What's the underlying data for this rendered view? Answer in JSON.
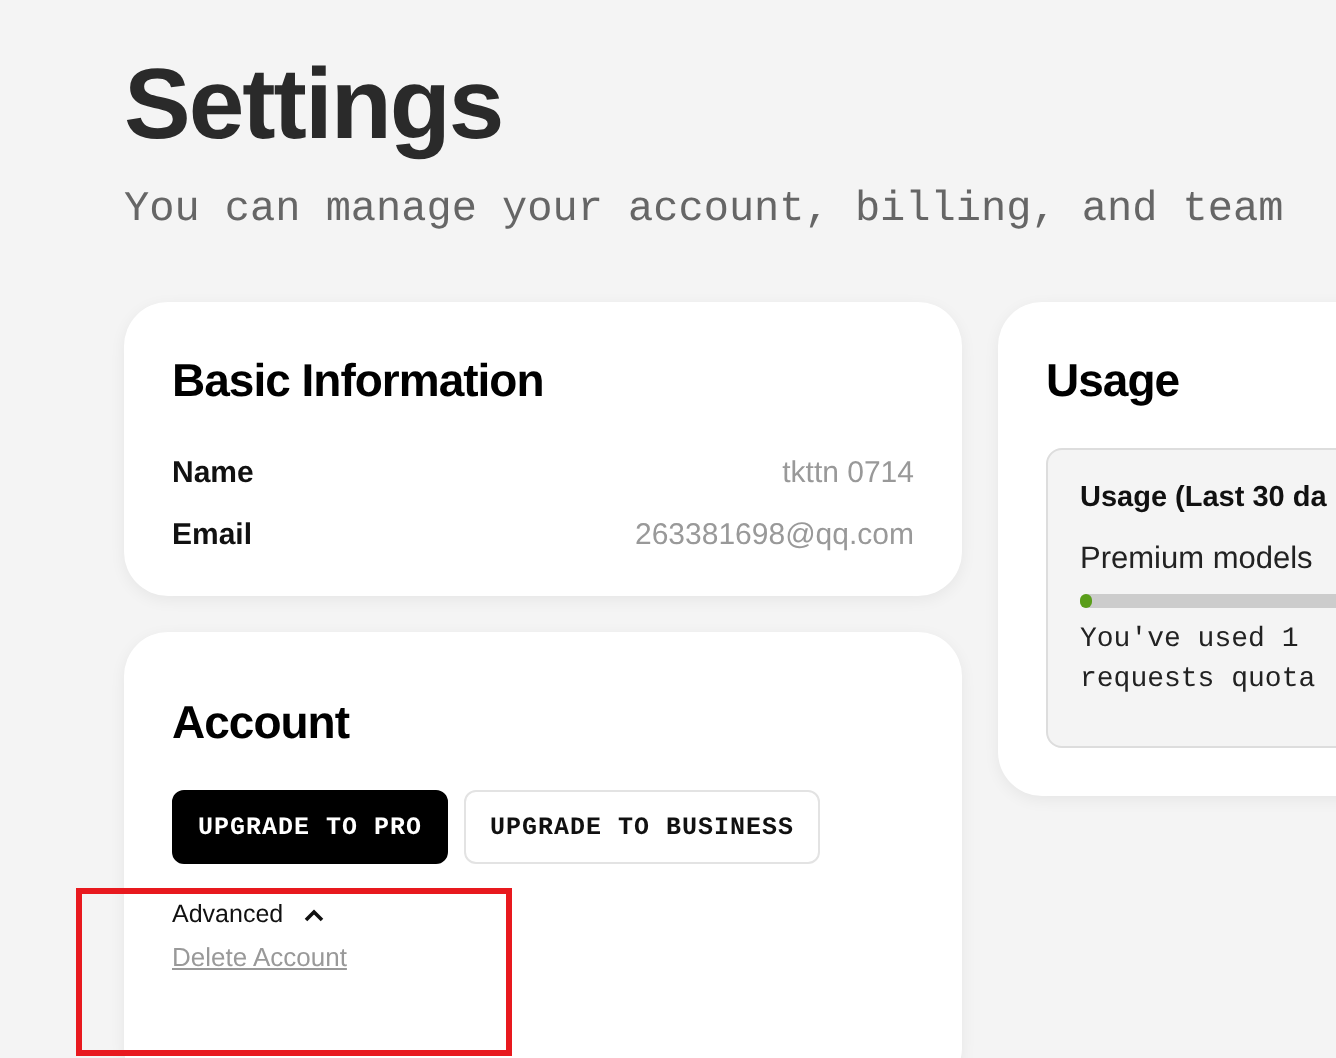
{
  "page": {
    "title": "Settings",
    "subtitle": "You can manage your account, billing, and team"
  },
  "basic_information": {
    "title": "Basic Information",
    "fields": [
      {
        "label": "Name",
        "value": "tkttn 0714"
      },
      {
        "label": "Email",
        "value": "263381698@qq.com"
      }
    ]
  },
  "account": {
    "title": "Account",
    "buttons": [
      {
        "label": "UPGRADE TO PRO",
        "kind": "primary"
      },
      {
        "label": "UPGRADE TO BUSINESS",
        "kind": "secondary"
      }
    ],
    "advanced": {
      "label": "Advanced",
      "expanded": true,
      "link": "Delete Account"
    }
  },
  "usage": {
    "title": "Usage",
    "box_title": "Usage (Last 30 da",
    "meter_label": "Premium models",
    "level": 0.015,
    "note_lines": [
      "You've used 1",
      "requests quota"
    ]
  },
  "annotation": {
    "kind": "highlight"
  }
}
